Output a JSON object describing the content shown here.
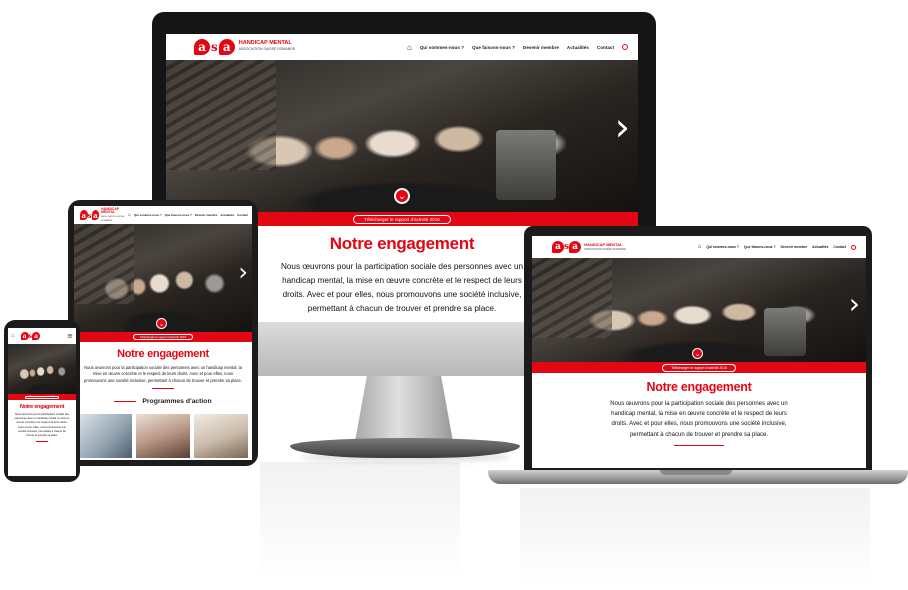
{
  "site": {
    "logo": {
      "letter_a": "a",
      "letter_s": "s",
      "title": "HANDICAP MENTAL",
      "subtitle": "ASSOCIATION SUISSE ROMANDE"
    },
    "nav": {
      "items": [
        "Qui sommes-nous ?",
        "Que faisons-nous ?",
        "Devenir membre",
        "Actualités",
        "Contact"
      ]
    },
    "hero": {
      "next_arrow": "›",
      "scroll_down": "⌄"
    },
    "cta_button": "Télécharger le rapport d'activité 2016",
    "heading": "Notre engagement",
    "paragraph": "Nous œuvrons pour la participation sociale des personnes avec un handicap mental, la mise en œuvre concrète et le respect de leurs droits. Avec et pour elles, nous promouvons une société inclusive, permettant à chacun de trouver et prendre sa place.",
    "section2_heading": "Programmes d'action",
    "monitor_paragraph_lines": [
      "Nous œuvrons pour la participation sociale des personnes avec un",
      "handicap mental, la mise en œuvre concrète et le respect de leurs",
      "droits. Avec et pour elles, nous promouvons une société inclusive,",
      "permettant à chacun de trouver et prendre sa place."
    ]
  },
  "colors": {
    "brand_red": "#e30613",
    "frame_dark": "#151515"
  },
  "icons": [
    "home-icon",
    "search-icon",
    "menu-icon",
    "chevron-right-icon",
    "chevron-down-icon"
  ]
}
